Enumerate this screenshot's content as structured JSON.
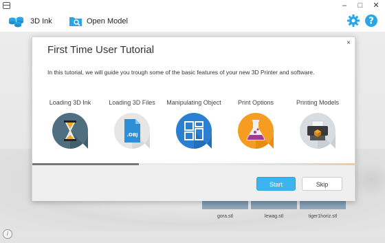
{
  "window": {
    "minimize": "–",
    "maximize": "□",
    "close": "✕"
  },
  "toolbar": {
    "ink_label": "3D Ink",
    "open_label": "Open Model",
    "gear_icon": "gear-icon",
    "help_icon": "help-icon"
  },
  "thumbnails": [
    {
      "label": "gora.stl"
    },
    {
      "label": "lewag.stl"
    },
    {
      "label": "tiger1horiz.stl"
    }
  ],
  "info": "i",
  "modal": {
    "title": "First Time User Tutorial",
    "description": "In this tutorial, we will guide you trough some of the basic features of your new 3D Printer and software.",
    "close": "×",
    "steps": [
      {
        "label": "Loading 3D Ink",
        "icon": "hourglass-icon"
      },
      {
        "label": "Loading 3D Files",
        "icon": "obj-file-icon"
      },
      {
        "label": "Manipulating Object",
        "icon": "layout-icon"
      },
      {
        "label": "Print Options",
        "icon": "flask-icon"
      },
      {
        "label": "Printing Models",
        "icon": "printer-icon"
      }
    ],
    "obj_text": ".OBJ",
    "progress": 0.33,
    "start_label": "Start",
    "skip_label": "Skip"
  },
  "colors": {
    "accent": "#3db4f0",
    "toolbar_icon": "#2aa6e8"
  }
}
